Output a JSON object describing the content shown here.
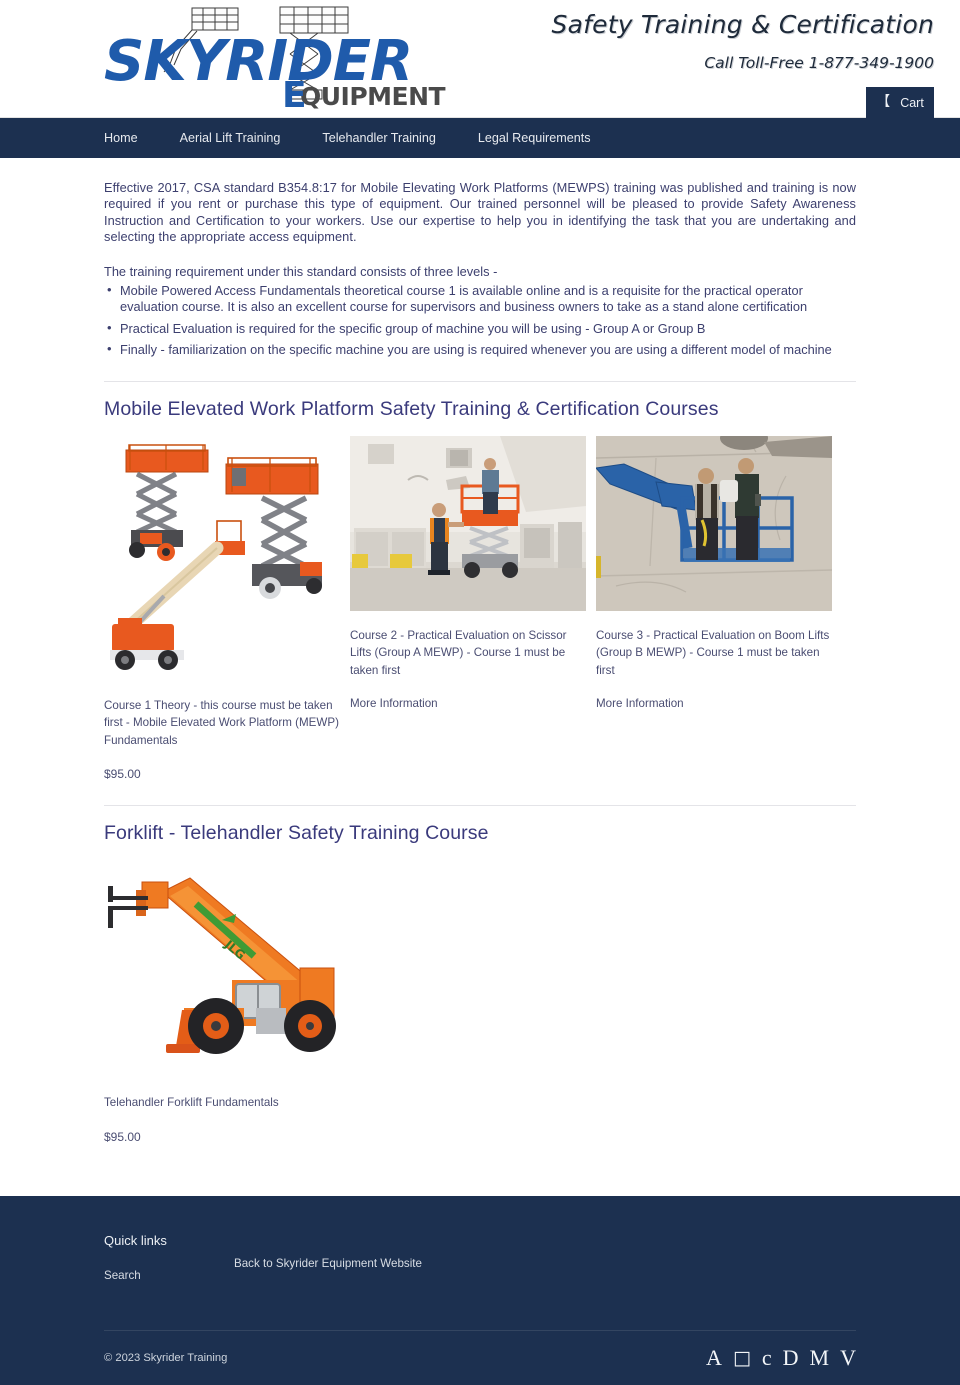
{
  "header": {
    "logo": {
      "word_primary": "SKYRIDER",
      "word_secondary": "EQUIPMENT",
      "primary_color": "#1f5bab",
      "secondary_color": "#4a4a4a",
      "alt": "Skyrider Equipment logo with boom lift and scissor lift illustrations"
    },
    "tagline": "Safety Training & Certification",
    "phone": "Call Toll-Free 1-877-349-1900",
    "cart": {
      "label": "Cart",
      "glyph": "【"
    }
  },
  "nav": {
    "items": [
      {
        "label": "Home"
      },
      {
        "label": "Aerial Lift Training"
      },
      {
        "label": "Telehandler Training"
      },
      {
        "label": "Legal Requirements"
      }
    ]
  },
  "main": {
    "intro": "Effective 2017, CSA standard B354.8:17 for Mobile Elevating Work Platforms (MEWPS) training was published and training is now required if you rent or purchase this type of equipment. Our trained personnel will be pleased to provide Safety Awareness Instruction and Certification to your workers. Use our expertise to help you in identifying the task that you are undertaking and selecting the appropriate access equipment.",
    "lead": "The training requirement under this standard consists of three levels -",
    "levels": [
      "Mobile Powered Access Fundamentals theoretical course 1 is available online and is a requisite for the practical operator evaluation course. It is also an excellent course for supervisors and business owners to take as a stand alone certification",
      "Practical Evaluation is required for the specific group of machine you will be using - Group A or Group B",
      "Finally - familiarization on the specific machine you are using is required whenever you are using a different model of machine"
    ],
    "sections": [
      {
        "title": "Mobile Elevated Work Platform Safety Training & Certification Courses",
        "courses": [
          {
            "caption": "Course 1 Theory - this course must be taken first - Mobile Elevated Work Platform (MEWP) Fundamentals",
            "price": "$95.00",
            "more_label": "",
            "image_alt": "Orange scissor lifts and articulating boom lift on white background"
          },
          {
            "caption": "Course 2 - Practical Evaluation on Scissor Lifts (Group A MEWP) - Course 1 must be taken first",
            "price": "",
            "more_label": "More Information",
            "image_alt": "Trainer instructing a worker operating an orange scissor lift inside a warehouse"
          },
          {
            "caption": "Course 3 - Practical Evaluation on Boom Lifts (Group B MEWP) - Course 1 must be taken first",
            "price": "",
            "more_label": "More Information",
            "image_alt": "Two workers wearing harnesses in a blue boom lift basket on a concrete lot"
          }
        ]
      },
      {
        "title": "Forklift - Telehandler Safety Training Course",
        "courses": [
          {
            "caption": "Telehandler Forklift Fundamentals",
            "price": "$95.00",
            "more_label": "",
            "image_alt": "Orange telehandler forklift with extended boom and forks"
          }
        ]
      }
    ]
  },
  "footer": {
    "quick_links_heading": "Quick links",
    "quick_links": [
      {
        "label": "Search"
      }
    ],
    "note_link": "Back to Skyrider Equipment Website",
    "copyright": "© 2023 Skyrider Training",
    "payment_glyphs": [
      "A",
      "□",
      "c",
      "D",
      "M",
      "V"
    ]
  },
  "colors": {
    "navy": "#1c3050",
    "brand_blue": "#1f5bab",
    "heading_indigo": "#3a3a7c",
    "body_text": "#3c3f6e"
  }
}
